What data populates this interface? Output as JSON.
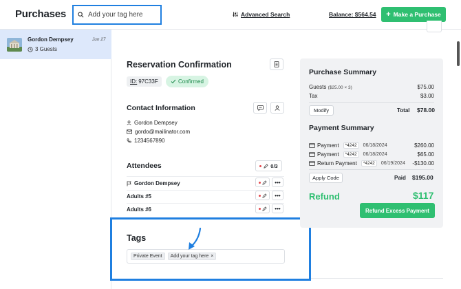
{
  "header": {
    "title": "Purchases",
    "search_placeholder": "Add your tag here",
    "advanced_search": "Advanced Search",
    "balance": "Balance: $564.54",
    "make_purchase": "Make a Purchase"
  },
  "sidebar": {
    "items": [
      {
        "name": "Gordon Dempsey",
        "date": "Jun 27",
        "guests": "3 Guests"
      }
    ]
  },
  "reservation": {
    "title": "Reservation Confirmation",
    "id_label": "ID:",
    "id_value": "97C33F",
    "status": "Confirmed"
  },
  "contact": {
    "title": "Contact Information",
    "name": "Gordon Dempsey",
    "email": "gordo@mailinator.com",
    "phone": "1234567890"
  },
  "attendees": {
    "title": "Attendees",
    "count": "0/3",
    "rows": [
      {
        "name": "Gordon Dempsey",
        "flag": true
      },
      {
        "name": "Adults #5",
        "flag": false
      },
      {
        "name": "Adults #6",
        "flag": false
      }
    ]
  },
  "tags": {
    "title": "Tags",
    "chips": [
      "Private Event",
      "Add your tag here"
    ]
  },
  "purchase_summary": {
    "title": "Purchase Summary",
    "guests_label": "Guests",
    "guests_detail": "($25.00 × 3)",
    "guests_amount": "$75.00",
    "tax_label": "Tax",
    "tax_amount": "$3.00",
    "modify": "Modify",
    "total_label": "Total",
    "total_amount": "$78.00"
  },
  "payment_summary": {
    "title": "Payment Summary",
    "payments": [
      {
        "label": "Payment",
        "card": "*4242",
        "date": "06/18/2024",
        "amount": "$260.00"
      },
      {
        "label": "Payment",
        "card": "*4242",
        "date": "06/18/2024",
        "amount": "$65.00"
      },
      {
        "label": "Return Payment",
        "card": "*4242",
        "date": "06/19/2024",
        "amount": "-$130.00"
      }
    ],
    "apply_code": "Apply Code",
    "paid_label": "Paid",
    "paid_amount": "$195.00",
    "refund_label": "Refund",
    "refund_amount": "$117",
    "refund_button": "Refund Excess Payment"
  },
  "colors": {
    "accent_green": "#2fbf71",
    "highlight_blue": "#1f7fe0",
    "sidebar_selected": "#dde8fb",
    "confirmed_bg": "#d7f4e3"
  }
}
